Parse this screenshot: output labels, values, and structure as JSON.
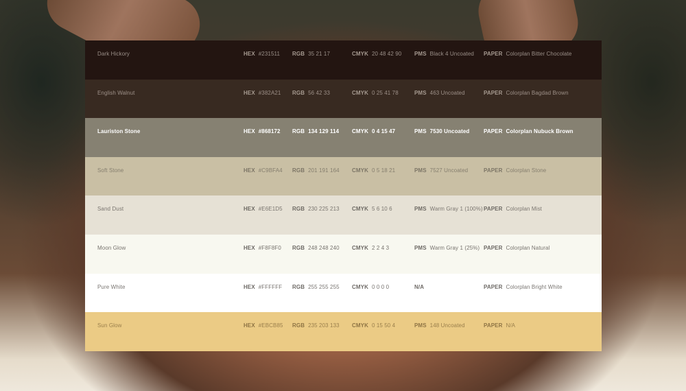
{
  "swatches": [
    {
      "name": "Dark Hickory",
      "hex": "#231511",
      "rgb": "35 21 17",
      "cmyk": "20 48 42 90",
      "pms": "Black 4 Uncoated",
      "paper": "Colorplan Bitter Chocolate",
      "bg": "#231511",
      "fg": "#9a8f88",
      "bold_fg": "#a59990"
    },
    {
      "name": "English Walnut",
      "hex": "#382A21",
      "rgb": "56 42 33",
      "cmyk": "0 25 41 78",
      "pms": "463 Uncoated",
      "paper": "Colorplan Bagdad Brown",
      "bg": "#382A21",
      "fg": "#9d9088",
      "bold_fg": "#a69a90"
    },
    {
      "name": "Lauriston Stone",
      "hex": "#868172",
      "rgb": "134 129 114",
      "cmyk": "0 4 15 47",
      "pms": "7530 Uncoated",
      "paper": "Colorplan Nubuck Brown",
      "bg": "#868172",
      "fg": "#ffffff",
      "bold_fg": "#ffffff"
    },
    {
      "name": "Soft Stone",
      "hex": "#C9BFA4",
      "rgb": "201 191 164",
      "cmyk": "0 5 18 21",
      "pms": "7527 Uncoated",
      "paper": "Colorplan Stone",
      "bg": "#C9BFA4",
      "fg": "#857e6e",
      "bold_fg": "#7c7566"
    },
    {
      "name": "Sand Dust",
      "hex": "#E6E1D5",
      "rgb": "230 225 213",
      "cmyk": "5 6 10 6",
      "pms": "Warm Gray 1 (100%)",
      "paper": "Colorplan Mist",
      "bg": "#E6E1D5",
      "fg": "#7b7670",
      "bold_fg": "#6e6a64"
    },
    {
      "name": "Moon Glow",
      "hex": "#F8F8F0",
      "rgb": "248 248 240",
      "cmyk": "2 2 4 3",
      "pms": "Warm Gray 1 (25%)",
      "paper": "Colorplan Natural",
      "bg": "#F8F8F0",
      "fg": "#77736e",
      "bold_fg": "#6c6864"
    },
    {
      "name": "Pure White",
      "hex": "#FFFFFF",
      "rgb": "255 255 255",
      "cmyk": "0 0 0 0",
      "pms": "N/A",
      "paper": "Colorplan Bright White",
      "bg": "#FFFFFF",
      "fg": "#7a7672",
      "bold_fg": "#6e6a66"
    },
    {
      "name": "Sun Glow",
      "hex": "#EBCB85",
      "rgb": "235 203 133",
      "cmyk": "0 15 50 4",
      "pms": "148 Uncoated",
      "paper": "N/A",
      "bg": "#EBCB85",
      "fg": "#9a7f4c",
      "bold_fg": "#8e7444"
    }
  ],
  "labels": {
    "hex": "HEX",
    "rgb": "RGB",
    "cmyk": "CMYK",
    "pms": "PMS",
    "paper": "PAPER"
  }
}
